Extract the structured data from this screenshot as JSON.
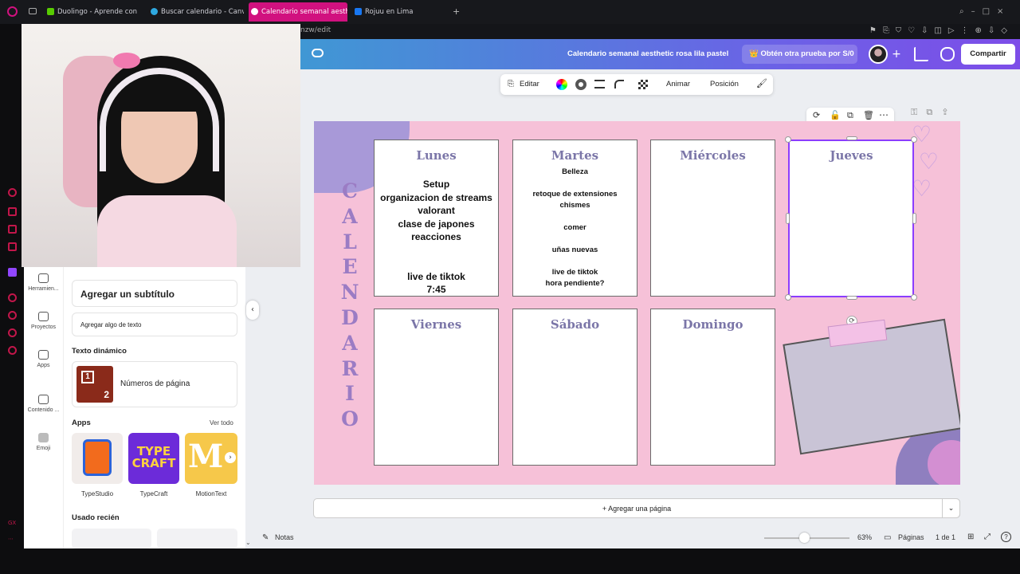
{
  "browser": {
    "tabs": [
      {
        "label": "Duolingo - Aprende con le",
        "color": "#58cc02"
      },
      {
        "label": "Buscar calendario - Canva",
        "color": "#2ea8e0"
      },
      {
        "label": "Calendario semanal aesth",
        "color": "#8b3dff"
      },
      {
        "label": "Rojuu en Lima",
        "color": "#1877f2"
      }
    ],
    "url": "nzw/edit"
  },
  "canva": {
    "doc_title": "Calendario semanal aesthetic rosa lila pastel",
    "trial_label": "👑 Obtén otra prueba por S/0",
    "share_label": "Compartir",
    "toolbar": {
      "edit": "Editar",
      "animate": "Animar",
      "position": "Posición"
    },
    "rail": [
      {
        "label": "Herramien..."
      },
      {
        "label": "Proyectos"
      },
      {
        "label": "Apps"
      },
      {
        "label": "Contenido ..."
      },
      {
        "label": "Emoji"
      }
    ],
    "panel": {
      "subtitle_btn": "Agregar un subtítulo",
      "body_btn": "Agregar algo de texto",
      "dynamic_title": "Texto dinámico",
      "page_numbers": "Números de página",
      "apps_title": "Apps",
      "see_all": "Ver todo",
      "apps": [
        "TypeStudio",
        "TypeCraft",
        "MotionText"
      ],
      "recent_title": "Usado recién"
    },
    "calendar": {
      "vertical_title": [
        "C",
        "A",
        "L",
        "E",
        "N",
        "D",
        "A",
        "R",
        "I",
        "O"
      ],
      "days": [
        {
          "name": "Lunes",
          "lines": [
            "Setup",
            "organizacion de streams",
            "valorant",
            "clase de japones",
            "reacciones",
            "",
            "",
            "live de tiktok",
            "7:45"
          ]
        },
        {
          "name": "Martes",
          "lines": [
            "Belleza",
            "",
            "retoque de extensiones",
            "chismes",
            "",
            "comer",
            "",
            "uñas nuevas",
            "",
            "live de tiktok",
            "hora pendiente?"
          ]
        },
        {
          "name": "Miércoles",
          "lines": []
        },
        {
          "name": "Jueves",
          "lines": []
        },
        {
          "name": "Viernes",
          "lines": []
        },
        {
          "name": "Sábado",
          "lines": []
        },
        {
          "name": "Domingo",
          "lines": []
        }
      ]
    },
    "add_page": "+ Agregar una página",
    "status": {
      "notes": "Notas",
      "zoom": "63%",
      "pages_label": "Páginas",
      "page_count": "1 de 1"
    }
  },
  "sidebar_bottom_text": "GX"
}
